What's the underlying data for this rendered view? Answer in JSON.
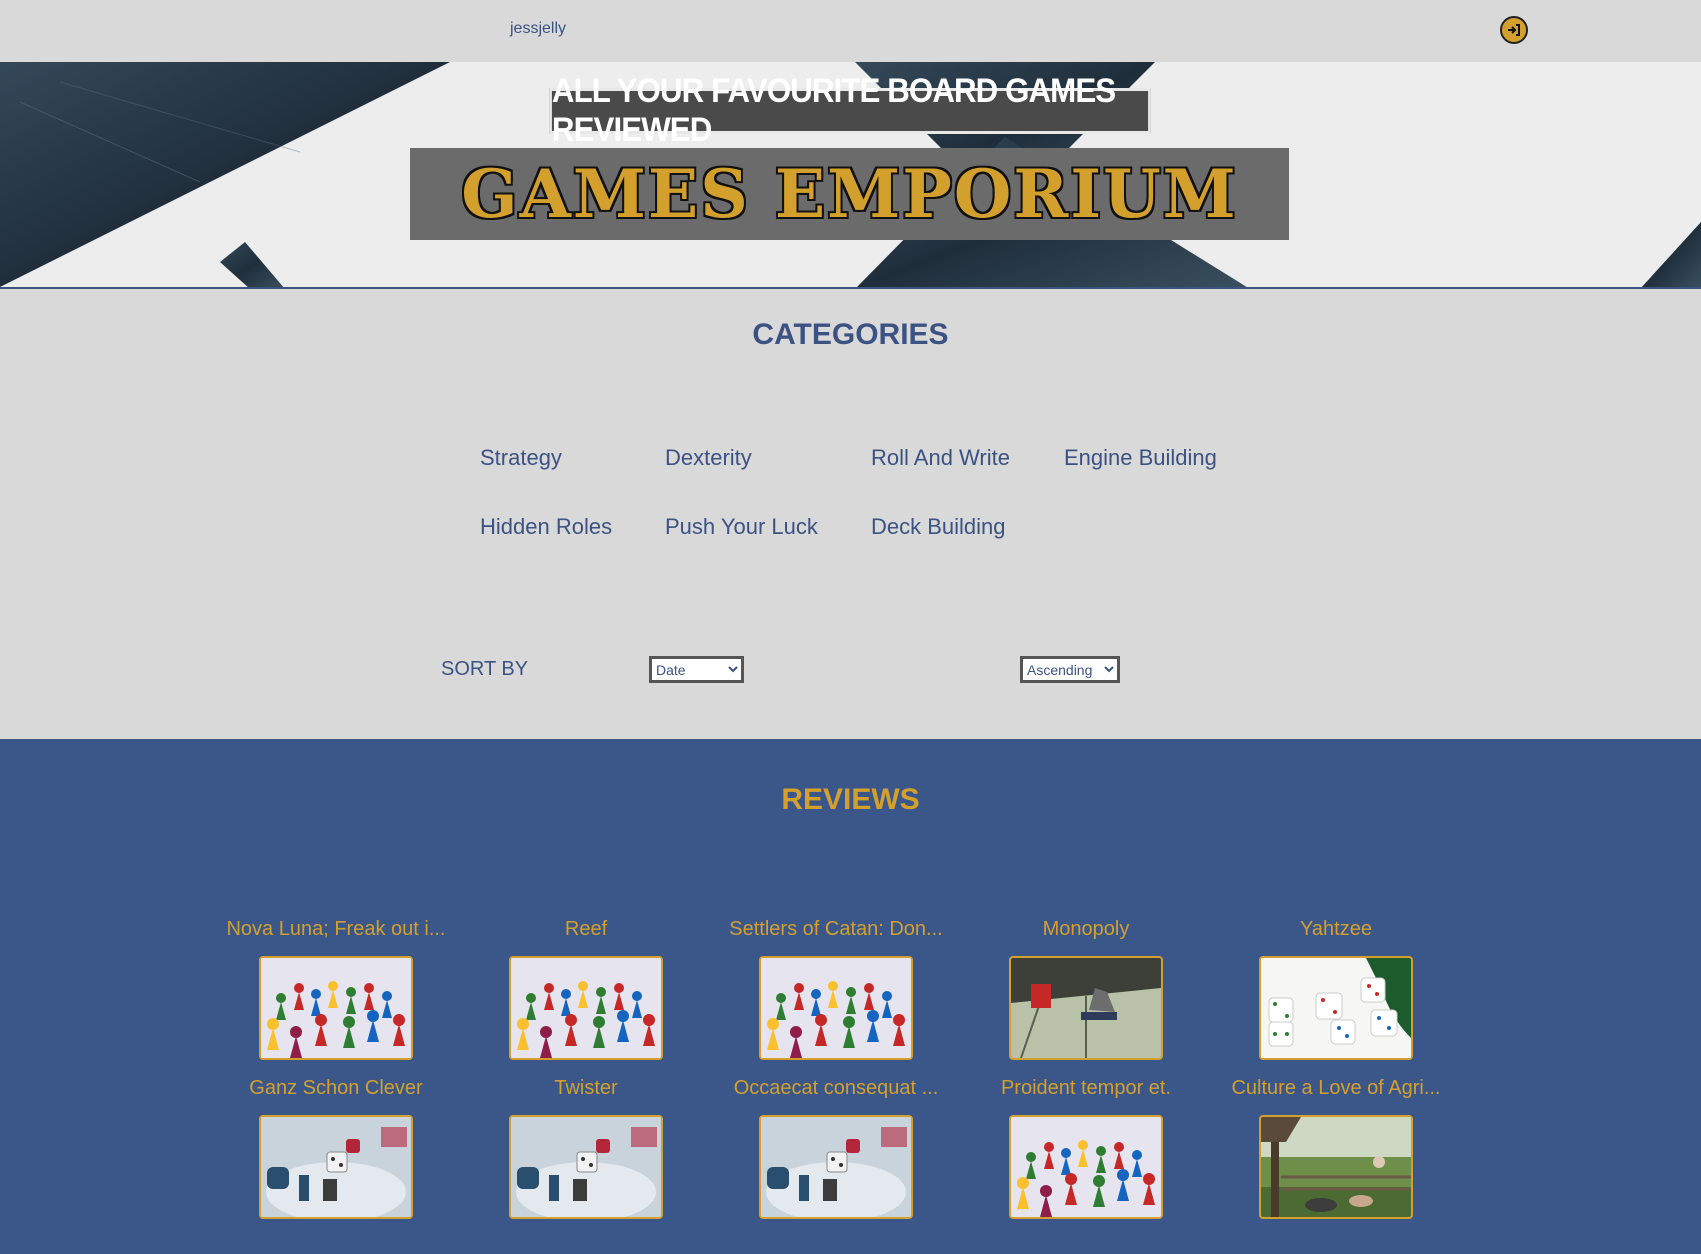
{
  "header": {
    "username": "jessjelly",
    "login_icon": "login-arrow-icon"
  },
  "banner": {
    "tagline": "ALL YOUR FAVOURITE BOARD GAMES REVIEWED",
    "title": "GAMES EMPORIUM"
  },
  "categories": {
    "heading": "CATEGORIES",
    "items": [
      "Strategy",
      "Dexterity",
      "Roll And Write",
      "Engine Building",
      "Hidden Roles",
      "Push Your Luck",
      "Deck Building"
    ]
  },
  "sort": {
    "label": "SORT BY",
    "field": {
      "selected": "Date"
    },
    "order": {
      "selected": "Ascending"
    }
  },
  "reviews": {
    "heading": "REVIEWS",
    "items": [
      {
        "title": "Nova Luna; Freak out i...",
        "image": "pawns"
      },
      {
        "title": "Reef",
        "image": "pawns"
      },
      {
        "title": "Settlers of Catan: Don...",
        "image": "pawns"
      },
      {
        "title": "Monopoly",
        "image": "monopoly"
      },
      {
        "title": "Yahtzee",
        "image": "dice"
      },
      {
        "title": "Ganz Schon Clever",
        "image": "boardgame"
      },
      {
        "title": "Twister",
        "image": "boardgame"
      },
      {
        "title": "Occaecat consequat ...",
        "image": "boardgame"
      },
      {
        "title": "Proident tempor et.",
        "image": "pawns"
      },
      {
        "title": "Culture a Love of Agri...",
        "image": "farm"
      }
    ]
  },
  "colors": {
    "navy": "#3b5283",
    "gold": "#d3a02e",
    "page_bg": "#d9d9d9",
    "reviews_bg": "#3b5688"
  }
}
